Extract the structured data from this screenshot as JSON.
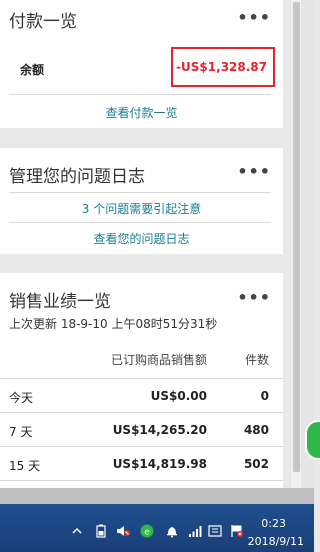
{
  "payment": {
    "title": "付款一览",
    "more": "•••",
    "balance_label": "余额",
    "balance_value": "-US$1,328.87",
    "link": "查看付款一览"
  },
  "issues": {
    "title": "管理您的问题日志",
    "more": "•••",
    "alert": "3 个问题需要引起注意",
    "link": "查看您的问题日志"
  },
  "sales": {
    "title": "销售业绩一览",
    "more": "•••",
    "updated": "上次更新 18-9-10 上午08时51分31秒",
    "columns": [
      "已订购商品销售额",
      "件数"
    ],
    "rows": [
      {
        "label": "今天",
        "amount": "US$0.00",
        "count": "0"
      },
      {
        "label": "7 天",
        "amount": "US$14,265.20",
        "count": "480"
      },
      {
        "label": "15 天",
        "amount": "US$14,819.98",
        "count": "502"
      }
    ]
  },
  "taskbar": {
    "time": "0:23",
    "date": "2018/9/11",
    "icons": [
      "chevron-up-icon",
      "battery-icon",
      "volume-muted-icon",
      "app-icon",
      "notification-icon",
      "signal-icon",
      "ime-icon",
      "flag-icon"
    ]
  },
  "colors": {
    "link": "#1a7d8f",
    "negative": "#e5252e",
    "taskbar": "#1a3f78"
  }
}
